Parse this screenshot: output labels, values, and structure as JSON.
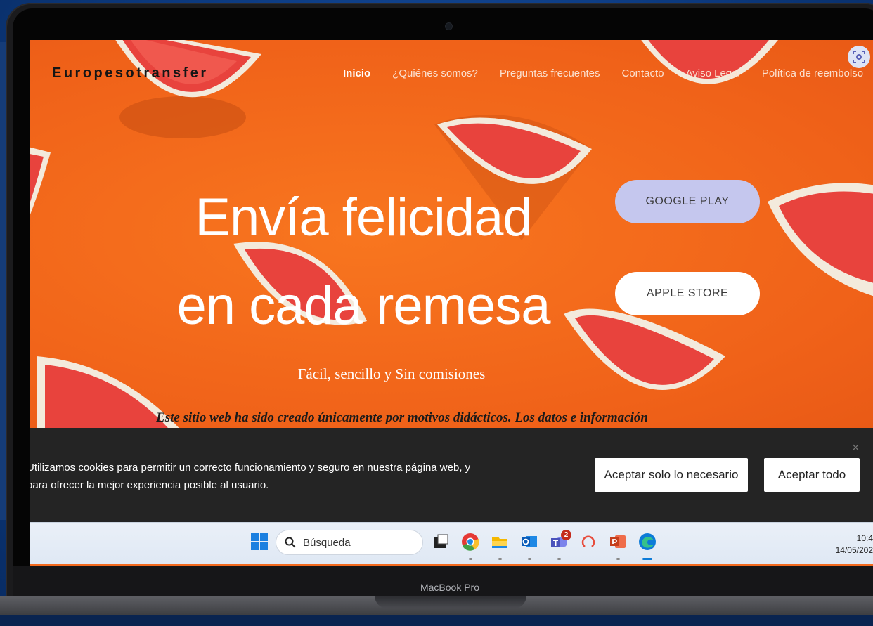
{
  "device": {
    "label": "MacBook Pro"
  },
  "header": {
    "brand": "Europesotransfer",
    "nav": [
      "Inicio",
      "¿Quiénes somos?",
      "Preguntas frecuentes",
      "Contacto",
      "Aviso Legal",
      "Política de reembolso"
    ]
  },
  "hero": {
    "headline_line1": "Envía felicidad",
    "headline_line2": "en cada remesa",
    "tagline": "Fácil, sencillo y Sin comisiones",
    "disclaimer": "Este sitio web ha sido creado únicamente por motivos didácticos. Los datos e información"
  },
  "store_buttons": {
    "google": "GOOGLE PLAY",
    "apple": "APPLE STORE"
  },
  "cookie_banner": {
    "text": "Utilizamos cookies para permitir un correcto funcionamiento y seguro en nuestra página web, y para ofrecer la mejor experiencia posible al usuario.",
    "close": "×",
    "accept_necessary": "Aceptar solo lo necesario",
    "accept_all": "Aceptar todo"
  },
  "taskbar": {
    "search_placeholder": "Búsqueda",
    "teams_badge": "2",
    "time": "10:4",
    "date": "14/05/202",
    "icons": [
      "windows-start-icon",
      "search-icon",
      "task-view-icon",
      "chrome-icon",
      "file-explorer-icon",
      "outlook-icon",
      "teams-icon",
      "office-icon",
      "powerpoint-icon",
      "edge-icon"
    ]
  },
  "colors": {
    "hero_orange": "#f36a1e",
    "cookie_bg": "#242424",
    "google_btn": "#c5c7ee",
    "apple_btn": "#ffffff",
    "taskbar": "#e6edf7"
  }
}
